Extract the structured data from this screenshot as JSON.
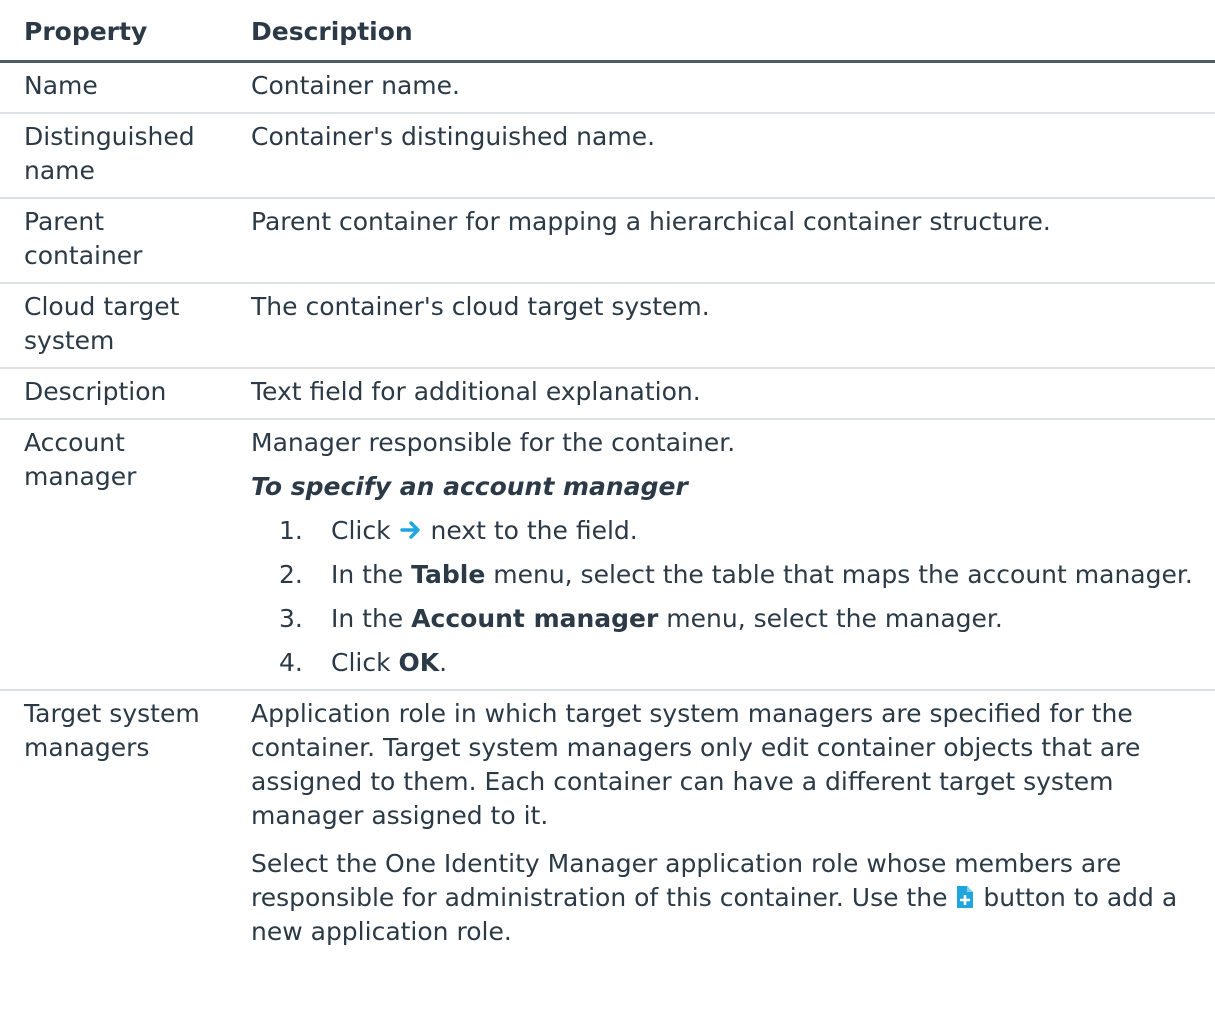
{
  "table": {
    "headers": {
      "property": "Property",
      "description": "Description"
    },
    "rows": [
      {
        "property": "Name",
        "description": "Container name."
      },
      {
        "property": "Distinguished name",
        "description": "Container's distinguished name."
      },
      {
        "property": "Parent container",
        "description": "Parent container for mapping a hierarchical container structure."
      },
      {
        "property": "Cloud target system",
        "description": "The container's cloud target system."
      },
      {
        "property": "Description",
        "description": "Text field for additional explanation."
      }
    ],
    "account_manager": {
      "property": "Account manager",
      "description": "Manager responsible for the container.",
      "procedure_title": "To specify an account manager",
      "steps": {
        "s1": {
          "num": "1.",
          "before": "Click",
          "after": "next to the field.",
          "icon": "arrow-right-icon"
        },
        "s2": {
          "num": "2.",
          "before": "In the",
          "bold": "Table",
          "after": "menu, select the table that maps the account manager."
        },
        "s3": {
          "num": "3.",
          "before": "In the",
          "bold": "Account manager",
          "after": "menu, select the manager."
        },
        "s4": {
          "num": "4.",
          "before": "Click",
          "bold": "OK",
          "after": "."
        }
      }
    },
    "target_system_managers": {
      "property": "Target system managers",
      "paragraph1": "Application role in which target system managers are specified for the container. Target system managers only edit container objects that are assigned to them. Each container can have a different target system manager assigned to it.",
      "paragraph2_before": "Select the One Identity Manager application role whose members are responsible for administration of this container. Use the",
      "paragraph2_after": "button to add a new application role.",
      "icon": "add-document-icon"
    }
  },
  "colors": {
    "text": "#2b3a46",
    "header_rule": "#4d5c66",
    "row_rule": "#dde1e4",
    "icon_accent": "#1fa6de"
  }
}
